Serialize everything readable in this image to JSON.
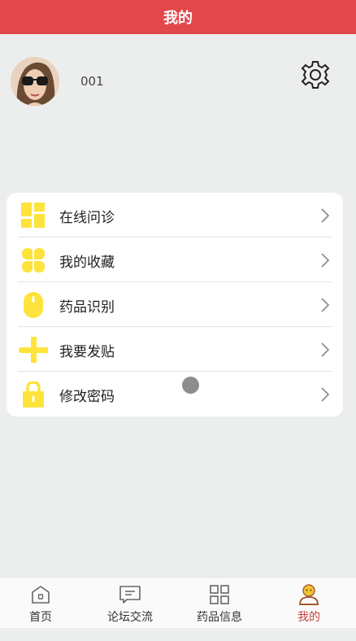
{
  "header": {
    "title": "我的"
  },
  "profile": {
    "username": "001"
  },
  "menu": {
    "items": [
      {
        "label": "在线问诊",
        "icon": "grid-blocks-icon"
      },
      {
        "label": "我的收藏",
        "icon": "clover-icon"
      },
      {
        "label": "药品识别",
        "icon": "mouse-icon"
      },
      {
        "label": "我要发贴",
        "icon": "plus-icon"
      },
      {
        "label": "修改密码",
        "icon": "lock-icon"
      }
    ]
  },
  "tabbar": {
    "items": [
      {
        "label": "首页",
        "icon": "home-icon"
      },
      {
        "label": "论坛交流",
        "icon": "chat-icon"
      },
      {
        "label": "药品信息",
        "icon": "grid-icon"
      },
      {
        "label": "我的",
        "icon": "user-icon",
        "active": true
      }
    ]
  },
  "colors": {
    "header": "#e2484b",
    "icon_yellow": "#fde33c",
    "active_tab": "#c8453e"
  }
}
